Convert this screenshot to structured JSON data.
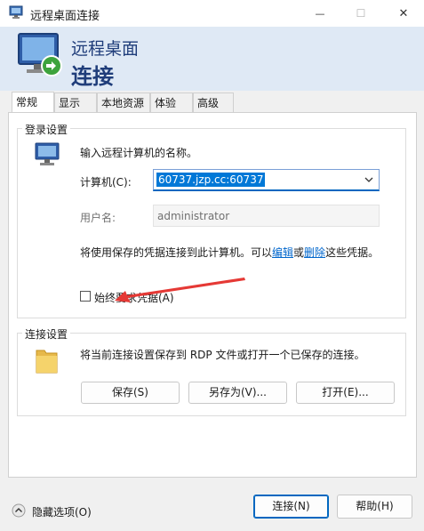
{
  "window": {
    "title": "远程桌面连接",
    "min_glyph": "—",
    "max_glyph": "☐",
    "close_glyph": "✕"
  },
  "banner": {
    "line1": "远程桌面",
    "line2": "连接"
  },
  "tabs": [
    {
      "label": "常规"
    },
    {
      "label": "显示"
    },
    {
      "label": "本地资源"
    },
    {
      "label": "体验"
    },
    {
      "label": "高级"
    }
  ],
  "login": {
    "group_title": "登录设置",
    "instruction": "输入远程计算机的名称。",
    "computer_label": "计算机(C):",
    "computer_value": "60737.jzp.cc:60737",
    "username_label": "用户名:",
    "username_value": "administrator",
    "saved_text_prefix": "将使用保存的凭据连接到此计算机。可以",
    "edit_link": "编辑",
    "or_text": "或",
    "delete_link": "删除",
    "saved_text_suffix": "这些凭据。",
    "always_ask_label": "始终要求凭据(A)"
  },
  "connection": {
    "group_title": "连接设置",
    "description": "将当前连接设置保存到 RDP 文件或打开一个已保存的连接。",
    "save_button": "保存(S)",
    "save_as_button": "另存为(V)...",
    "open_button": "打开(E)..."
  },
  "footer": {
    "hide_options": "隐藏选项(O)",
    "connect_button": "连接(N)",
    "help_button": "帮助(H)"
  },
  "colors": {
    "accent": "#0067c0",
    "banner_bg": "#dfe9f5",
    "banner_text": "#1f3d7a",
    "annotation_arrow": "#e53935"
  }
}
